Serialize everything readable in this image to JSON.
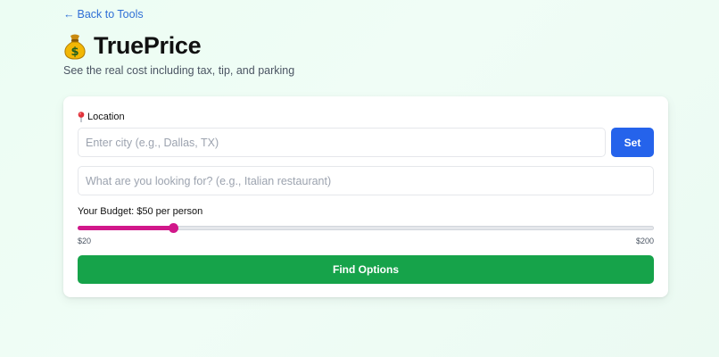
{
  "nav": {
    "back_label": "Back to Tools",
    "back_icon": "arrow-left-icon"
  },
  "header": {
    "icon": "money-bag-icon",
    "title": "TruePrice",
    "subtitle": "See the real cost including tax, tip, and parking"
  },
  "form": {
    "location": {
      "icon": "round-pushpin-icon",
      "label": "Location",
      "value": "",
      "placeholder": "Enter city (e.g., Dallas, TX)",
      "set_label": "Set"
    },
    "query": {
      "value": "",
      "placeholder": "What are you looking for? (e.g., Italian restaurant)"
    },
    "budget": {
      "label": "Your Budget: $50 per person",
      "value": 50,
      "min": 20,
      "max": 200,
      "min_label": "$20",
      "max_label": "$200"
    },
    "submit_label": "Find Options"
  },
  "colors": {
    "link": "#2f6fd6",
    "primary_button": "#2563eb",
    "submit_button": "#16a34a",
    "slider_accent": "#d1178a",
    "background": "#ecfdf3"
  }
}
